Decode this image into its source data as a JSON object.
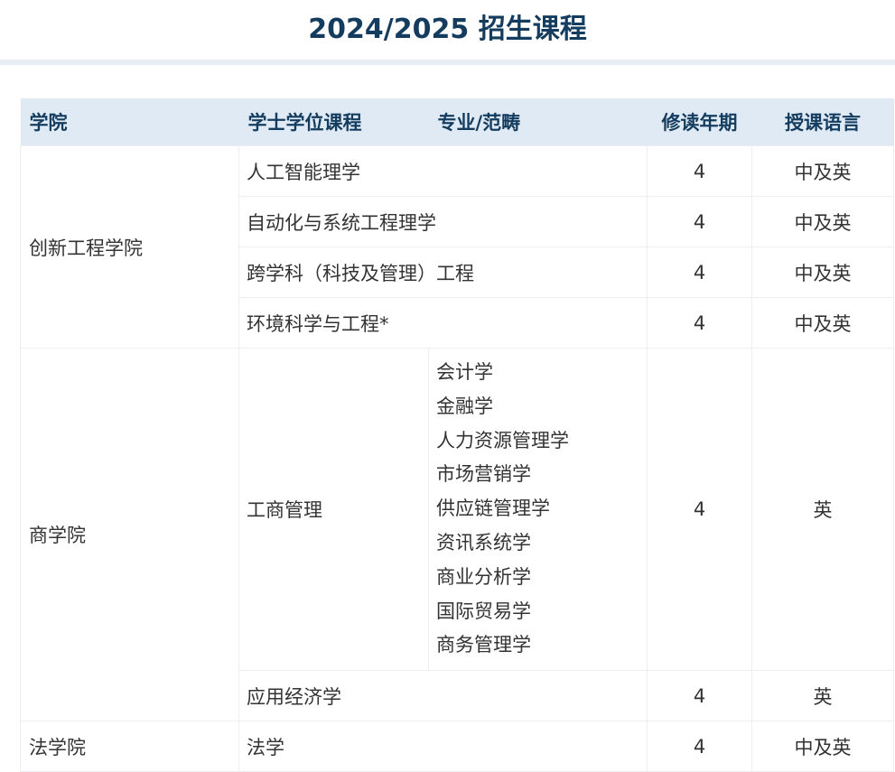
{
  "title": "2024/2025 招生课程",
  "headers": {
    "college": "学院",
    "program": "学士学位课程",
    "major": "专业/范畴",
    "duration": "修读年期",
    "language": "授课语言"
  },
  "colleges": {
    "engineering": "创新工程学院",
    "business": "商学院",
    "law": "法学院"
  },
  "rows": {
    "ai": {
      "program": "人工智能理学",
      "duration": "4",
      "language": "中及英"
    },
    "automation": {
      "program": "自动化与系统工程理学",
      "duration": "4",
      "language": "中及英"
    },
    "interdisciplinary": {
      "program": "跨学科（科技及管理）工程",
      "duration": "4",
      "language": "中及英"
    },
    "environment": {
      "program": "环境科学与工程*",
      "duration": "4",
      "language": "中及英"
    },
    "business_admin": {
      "program": "工商管理",
      "majors": [
        "会计学",
        "金融学",
        "人力资源管理学",
        "市场营销学",
        "供应链管理学",
        "资讯系统学",
        "商业分析学",
        "国际贸易学",
        "商务管理学"
      ],
      "duration": "4",
      "language": "英"
    },
    "economics": {
      "program": "应用经济学",
      "duration": "4",
      "language": "英"
    },
    "law": {
      "program": "法学",
      "duration": "4",
      "language": "中及英"
    }
  }
}
